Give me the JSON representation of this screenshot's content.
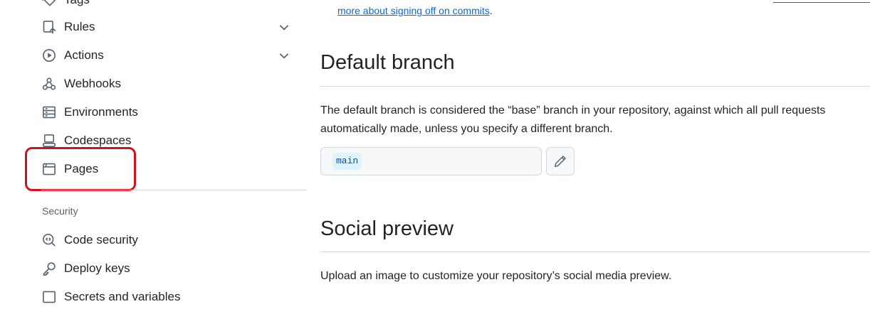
{
  "sidebar": {
    "partial_top_label": "Tags",
    "items": [
      {
        "label": "Rules",
        "icon": "rules-icon",
        "expandable": true
      },
      {
        "label": "Actions",
        "icon": "play-icon",
        "expandable": true
      },
      {
        "label": "Webhooks",
        "icon": "webhook-icon",
        "expandable": false
      },
      {
        "label": "Environments",
        "icon": "server-icon",
        "expandable": false
      },
      {
        "label": "Codespaces",
        "icon": "codespaces-icon",
        "expandable": false
      },
      {
        "label": "Pages",
        "icon": "browser-icon",
        "expandable": false
      }
    ],
    "security_section": {
      "label": "Security",
      "items": [
        {
          "label": "Code security",
          "icon": "codescan-icon"
        },
        {
          "label": "Deploy keys",
          "icon": "key-icon"
        },
        {
          "label": "Secrets and variables",
          "icon": "asterisk-icon"
        }
      ]
    },
    "highlight_color": "#d1121e"
  },
  "main": {
    "top_link_text": "more about signing off on commits",
    "top_link_suffix": ".",
    "default_branch": {
      "heading": "Default branch",
      "description_line1": "The default branch is considered the “base” branch in your repository, against which all pull requests",
      "description_line2": "automatically made, unless you specify a different branch.",
      "branch_name": "main"
    },
    "social_preview": {
      "heading": "Social preview",
      "description": "Upload an image to customize your repository’s social media preview."
    }
  },
  "colors": {
    "link": "#0969da",
    "text": "#1f2328",
    "muted": "#59636e",
    "border": "#d1d9e0",
    "pill_bg": "#ddf4ff"
  }
}
